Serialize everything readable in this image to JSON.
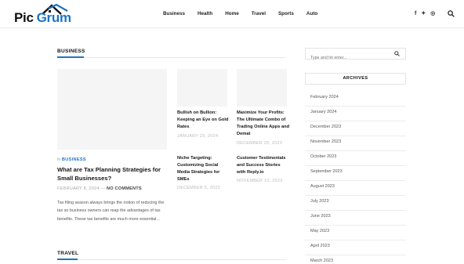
{
  "logo": {
    "part1": "Pic",
    "part2": "Grum"
  },
  "nav": [
    "Business",
    "Health",
    "Home",
    "Travel",
    "Sports",
    "Auto"
  ],
  "social": [
    "f",
    "✦",
    "◎"
  ],
  "colors": {
    "accent": "#1f74c4",
    "text": "#161616",
    "muted": "#aaaaaa"
  },
  "icons": {
    "search": "search-icon",
    "facebook": "facebook-icon",
    "twitter": "twitter-icon",
    "instagram": "instagram-icon",
    "logo": "house-roof-icon"
  },
  "business": {
    "heading": "BUSINESS",
    "main": {
      "category_prefix": "in",
      "category": "BUSINESS",
      "title": "What are Tax Planning Strategies for Small Businesses?",
      "date": "FEBRUARY 8, 2024",
      "dash": "—",
      "comments": "NO COMMENTS",
      "excerpt": "Tax filing season always brings the notion of reducing the tax so business owners can reap the advantages of tax benefits. These tax benefits are much more essential..."
    },
    "small": [
      {
        "title": "Bullish on Bullion: Keeping an Eye on Gold Rates",
        "date": "JANUARY 23, 2024"
      },
      {
        "title": "Maximize Your Profits: The Ultimate Combo of Trading Online Apps and Demat",
        "date": "DECEMBER 29, 2023"
      },
      {
        "title": "Niche Targeting: Customizing Social Media Strategies for SMEs",
        "date": "DECEMBER 5, 2023"
      },
      {
        "title": "Customer Testimonials and Success Stories with Reply.io",
        "date": "NOVEMBER 10, 2023"
      }
    ]
  },
  "travel": {
    "heading": "TRAVEL"
  },
  "sidebar": {
    "search_placeholder": "Type and hit enter...",
    "archives_title": "ARCHIVES",
    "archives": [
      "February 2024",
      "January 2024",
      "December 2023",
      "November 2023",
      "October 2023",
      "September 2023",
      "August 2023",
      "July 2023",
      "June 2023",
      "May 2023",
      "April 2023",
      "March 2023"
    ]
  }
}
